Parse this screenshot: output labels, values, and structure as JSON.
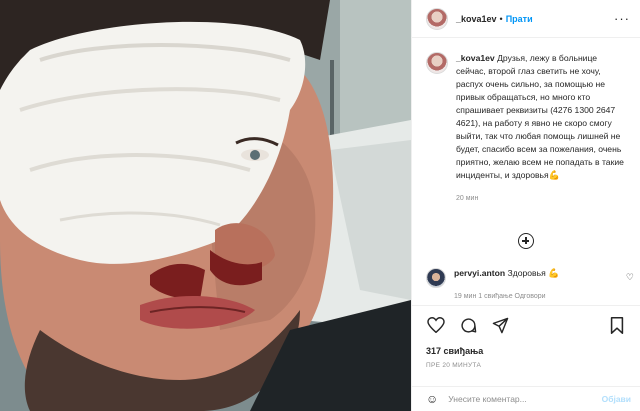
{
  "post": {
    "author": "_kova1ev",
    "follow_label": "Прати",
    "dot": "•",
    "more_label": "···",
    "caption": "Друзья, лежу в больнице сейчас, второй глаз светить не хочу, распух очень сильно, за помощью не привык обращаться, но много кто спрашивает реквизиты (4276 1300 2647 4621), на работу я явно не скоро смогу выйти, так что любая помощь лишней не будет, спасибо всем за пожелания, очень приятно, желаю всем не попадать в такие инциденты, и здоровья",
    "caption_time": "20 мин",
    "emoji": "💪"
  },
  "comments": [
    {
      "author": "pervyi.anton",
      "text": "Здоровья",
      "meta": "19 мин  1 свиђање  Одговори"
    }
  ],
  "actions": {
    "likes": "317 свиђања",
    "posted_ago": "ПРЕ 20 МИНУТА"
  },
  "add_comment": {
    "placeholder": "Унесите коментар...",
    "post_label": "Објави"
  },
  "colors": {
    "accent": "#0095f6",
    "muted": "#8e8e8e",
    "post_disabled": "#b2dffc"
  }
}
